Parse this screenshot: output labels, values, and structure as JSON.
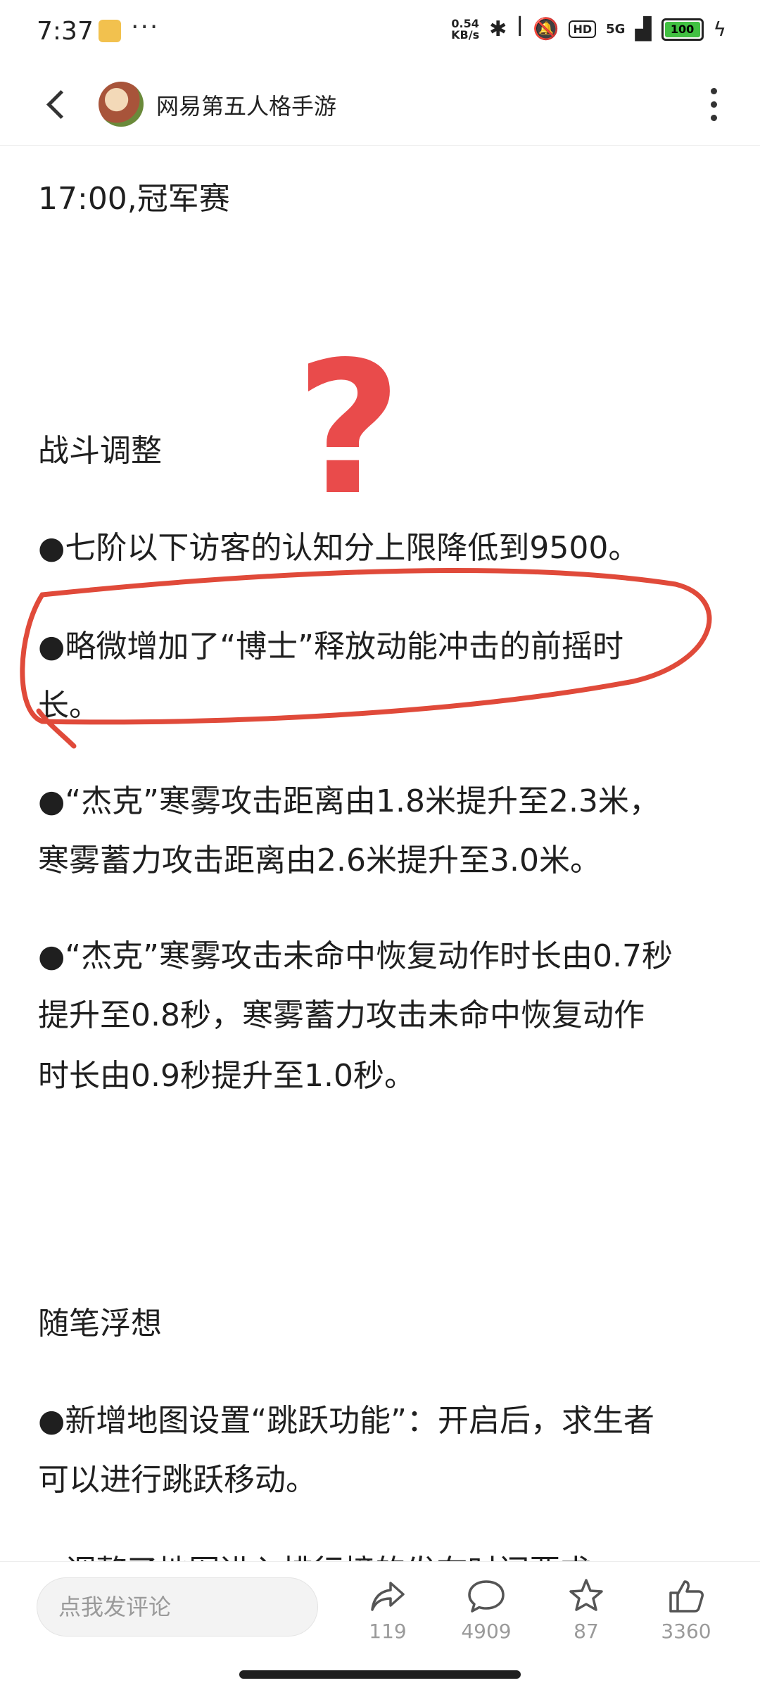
{
  "status_bar": {
    "time": "7:37",
    "dots": "···",
    "net_speed_value": "0.54",
    "net_speed_unit": "KB/s",
    "hd": "HD",
    "network": "5G",
    "battery": "100"
  },
  "header": {
    "title": "网易第五人格手游"
  },
  "article": {
    "time_line": "17:00,冠军赛",
    "section1_title": "战斗调整",
    "item1": "●七阶以下访客的认知分上限降低到9500。",
    "item2_line1": "●略微增加了“博士”释放动能冲击的前摇时",
    "item2_line2": "长。",
    "item3_line1": "●“杰克”寒雾攻击距离由1.8米提升至2.3米，",
    "item3_line2": "寒雾蓄力攻击距离由2.6米提升至3.0米。",
    "item4_line1": "●“杰克”寒雾攻击未命中恢复动作时长由0.7秒",
    "item4_line2": "提升至0.8秒，寒雾蓄力攻击未命中恢复动作",
    "item4_line3": "时长由0.9秒提升至1.0秒。",
    "section2_title": "随笔浮想",
    "item5_line1": "●新增地图设置“跳跃功能”：开启后，求生者",
    "item5_line2": "可以进行跳跃移动。",
    "item6_partial": "●调整了地图进入排行榜的发布时间要求"
  },
  "annotation": {
    "question_mark": "?",
    "color": "#e94b4b"
  },
  "bottom_bar": {
    "comment_placeholder": "点我发评论",
    "share_count": "119",
    "comment_count": "4909",
    "favorite_count": "87",
    "like_count": "3360"
  }
}
